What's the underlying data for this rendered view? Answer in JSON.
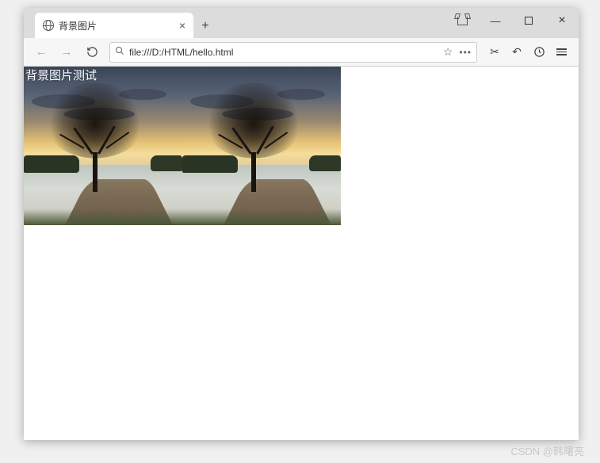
{
  "browser": {
    "tab_title": "背景图片",
    "url": "file:///D:/HTML/hello.html"
  },
  "page": {
    "overlay_text": "背景图片测试"
  },
  "watermark": "CSDN @韩曙亮"
}
